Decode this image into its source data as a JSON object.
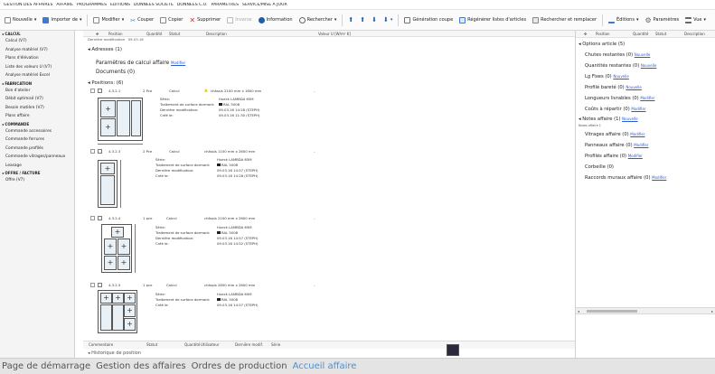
{
  "menubar": [
    "GESTION DES AFFAIRES",
    "AFFAIRE",
    "PROGRAMMES",
    "ÉDITIONS",
    "DONNÉES SOCIÉTÉ",
    "DONNÉES C.U.",
    "PARAMÈTRES",
    "SERVICE/MISE À JOUR"
  ],
  "toolbar": {
    "nouvelle": "Nouvelle",
    "importer": "Importer de",
    "modifier": "Modifier",
    "couper": "Couper",
    "copier": "Copier",
    "supprimer": "Supprimer",
    "inverse": "Inverse",
    "information": "Information",
    "rechercher": "Rechercher",
    "generation": "Génération coupe",
    "regenerer": "Régénérer listes d'articles",
    "rechercher_remplacer": "Rechercher et remplacer",
    "editions": "Éditions",
    "parametres": "Paramètres",
    "vue": "Vue"
  },
  "sidebar": {
    "sections": [
      {
        "title": "CALCUL",
        "items": [
          "Calcul (V7)",
          "Analyse matériel (V7)",
          "Plans d'élévation",
          "Liste des valeurs U (V7)",
          "Analyse matériel Excel"
        ]
      },
      {
        "title": "FABRICATION",
        "items": [
          "Bon d'atelier",
          "Débit optimisé (V7)",
          "Besoin matière (V7)",
          "Plans affaire"
        ]
      },
      {
        "title": "COMMANDE",
        "items": [
          "Commande accessoires",
          "Commande ferrures",
          "Commande profilés",
          "Commande vitrages/panneaux",
          "Leasage"
        ]
      },
      {
        "title": "OFFRE / FACTURE",
        "items": [
          "Offre (V7)"
        ]
      }
    ]
  },
  "main": {
    "col_headers": {
      "position": "Position",
      "quantite": "Quantité",
      "statut": "Statut",
      "description": "Description",
      "valeur_u": "Valeur U [W/m² K]"
    },
    "derniere_mod_label": "Dernière modification",
    "derniere_mod_value": "09.03.16",
    "adresses": "Adresses (1)",
    "param_calcul": "Paramètres de calcul affaire",
    "param_calcul_link": "Modifier",
    "documents": "Documents (0)",
    "positions_title": "Positions: (6)",
    "positions": [
      {
        "pos": "4.3.2.1",
        "qty": "2 Pce",
        "status": "Calcul",
        "desc": "châssis 2100 mm x 1600 mm",
        "warn": true,
        "serie": "Hueck LAMBDA 65M",
        "traitement": "RAL 5008",
        "derniere": "09.03.16 14:28 (STEPH)",
        "cree": "09.03.16 11:30 (STEPH)"
      },
      {
        "pos": "4.3.2.3",
        "qty": "2 Pce",
        "status": "Calcul",
        "desc": "châssis 1100 mm x 2600 mm",
        "warn": false,
        "serie": "Hueck LAMBDA 65M",
        "traitement": "RAL 5008",
        "derniere": "09.03.16 14:57 (STEPH)",
        "cree": "09.03.16 14:28 (STEPH)"
      },
      {
        "pos": "4.3.2.4",
        "qty": "1 pce",
        "status": "Calcul",
        "desc": "châssis 2100 mm x 2600 mm",
        "warn": false,
        "serie": "Hueck LAMBDA 65M",
        "traitement": "RAL 5008",
        "derniere": "09.03.16 14:57 (STEPH)",
        "cree": "09.03.16 14:52 (STEPH)"
      },
      {
        "pos": "4.3.2.5",
        "qty": "1 pce",
        "status": "Calcul",
        "desc": "châssis 2800 mm x 2600 mm",
        "warn": false,
        "serie": "Hueck LAMBDA 65M",
        "traitement": "RAL 5008",
        "derniere": "",
        "cree": "09.03.16 14:57 (STEPH)"
      }
    ],
    "labels": {
      "serie": "Série:",
      "traitement": "Traitement de surface dormant:",
      "derniere": "Dernière modification:",
      "cree": "Créé le:"
    },
    "bottom_headers": {
      "commentaire": "Commentaire",
      "statut": "Statut",
      "quantite": "Quantité",
      "utilisateur": "Utilisateur",
      "derniere": "Dernière modif.",
      "serie": "Série"
    },
    "historique": "Historique de position"
  },
  "right": {
    "col_headers": {
      "position": "Position",
      "quantite": "Quantité",
      "statut": "Statut",
      "description": "Description"
    },
    "options_title": "Options article (5)",
    "items": [
      {
        "label": "Chutes restantes (0)",
        "link": "Nouvelle"
      },
      {
        "label": "Quantités restantes (0)",
        "link": "Nouvelle"
      },
      {
        "label": "Lg Fixes (0)",
        "link": "Nouvelle"
      },
      {
        "label": "Profilé bareté (0)",
        "link": "Nouvelle"
      },
      {
        "label": "Longueurs livrables (0)",
        "link": "Modifier"
      },
      {
        "label": "Coûts à répartir (0)",
        "link": "Modifier"
      }
    ],
    "notes_title": "Notes affaire (1)",
    "notes_link": "Nouvelle",
    "notes_sub": "Notes affaire 1",
    "items2": [
      {
        "label": "Vitrages affaire (0)",
        "link": "Modifier"
      },
      {
        "label": "Panneaux affaire (0)",
        "link": "Modifier"
      },
      {
        "label": "Profilés affaire (0)",
        "link": "Modifier"
      },
      {
        "label": "Corbeille (0)",
        "link": ""
      },
      {
        "label": "Raccords muraux affaire (0)",
        "link": "Modifier"
      }
    ]
  },
  "tabs": [
    "Page de démarrage",
    "Gestion des affaires",
    "Ordres de production",
    "Accueil affaire"
  ],
  "colors": {
    "accent": "#4a90d9",
    "link": "#2a5bd7",
    "warning": "#f5c400"
  }
}
